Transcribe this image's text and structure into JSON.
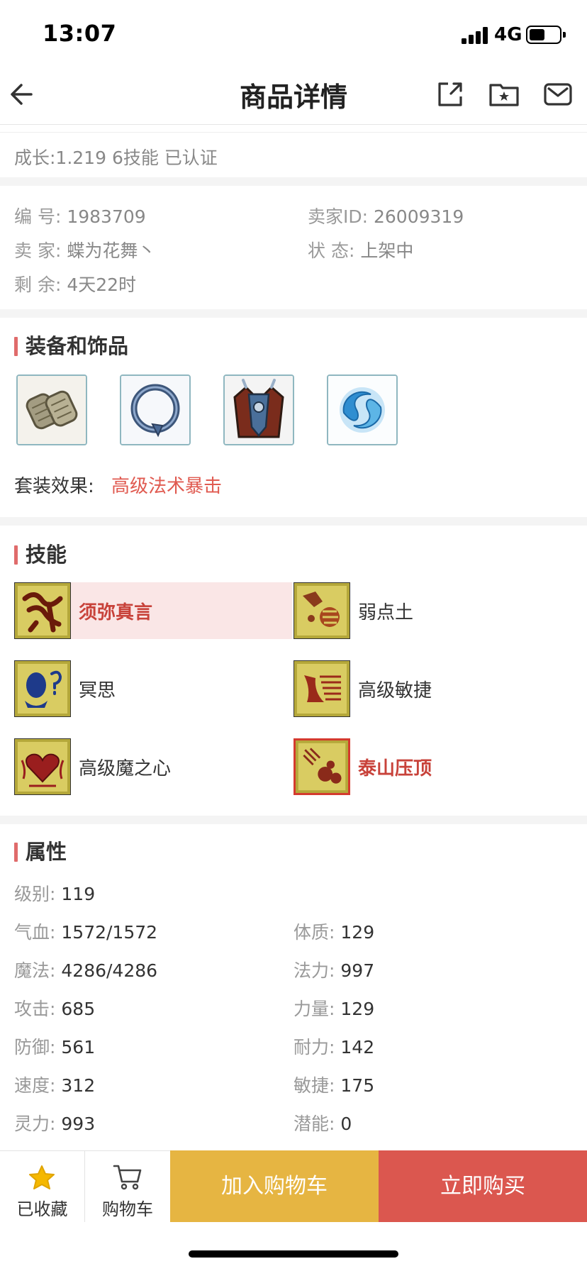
{
  "status_bar": {
    "time": "13:07",
    "network": "4G",
    "battery_level": 0.55
  },
  "nav": {
    "title": "商品详情",
    "icons": [
      "back-arrow-icon",
      "share-icon",
      "favorite-folder-icon",
      "message-icon"
    ]
  },
  "growth": "成长:1.219 6技能 已认证",
  "info": {
    "id_label": "编 号:",
    "id_value": "1983709",
    "seller_id_label": "卖家ID:",
    "seller_id_value": "26009319",
    "seller_label": "卖 家:",
    "seller_value": "蝶为花舞丶",
    "status_label": "状 态:",
    "status_value": "上架中",
    "remaining_label": "剩 余:",
    "remaining_value": "4天22时"
  },
  "equipment": {
    "title": "装备和饰品",
    "items": [
      "bracer-icon",
      "ring-icon",
      "armor-icon",
      "spirit-orb-icon"
    ],
    "set_label": "套装效果:",
    "set_value": "高级法术暴击"
  },
  "skills": {
    "title": "技能",
    "items": [
      {
        "name": "须弥真言",
        "icon": "sumeru-mantra-icon",
        "highlighted": true
      },
      {
        "name": "弱点土",
        "icon": "earth-weakness-icon",
        "highlighted": false
      },
      {
        "name": "冥思",
        "icon": "meditation-icon",
        "highlighted": false
      },
      {
        "name": "高级敏捷",
        "icon": "advanced-agility-icon",
        "highlighted": false
      },
      {
        "name": "高级魔之心",
        "icon": "advanced-magic-heart-icon",
        "highlighted": false
      },
      {
        "name": "泰山压顶",
        "icon": "mount-tai-crush-icon",
        "highlighted": true
      }
    ]
  },
  "attributes": {
    "title": "属性",
    "level_label": "级别:",
    "level_value": "119",
    "rows": [
      {
        "left_label": "气血:",
        "left_value": "1572/1572",
        "right_label": "体质:",
        "right_value": "129"
      },
      {
        "left_label": "魔法:",
        "left_value": "4286/4286",
        "right_label": "法力:",
        "right_value": "997"
      },
      {
        "left_label": "攻击:",
        "left_value": "685",
        "right_label": "力量:",
        "right_value": "129"
      },
      {
        "left_label": "防御:",
        "left_value": "561",
        "right_label": "耐力:",
        "right_value": "142"
      },
      {
        "left_label": "速度:",
        "left_value": "312",
        "right_label": "敏捷:",
        "right_value": "175"
      },
      {
        "left_label": "灵力:",
        "left_value": "993",
        "right_label": "潜能:",
        "right_value": "0"
      }
    ]
  },
  "bottom_bar": {
    "favorited_label": "已收藏",
    "cart_label": "购物车",
    "add_to_cart_label": "加入购物车",
    "buy_now_label": "立即购买"
  },
  "colors": {
    "accent_red": "#db574f",
    "accent_yellow": "#e6b542",
    "section_marker": "#e06b6b"
  }
}
